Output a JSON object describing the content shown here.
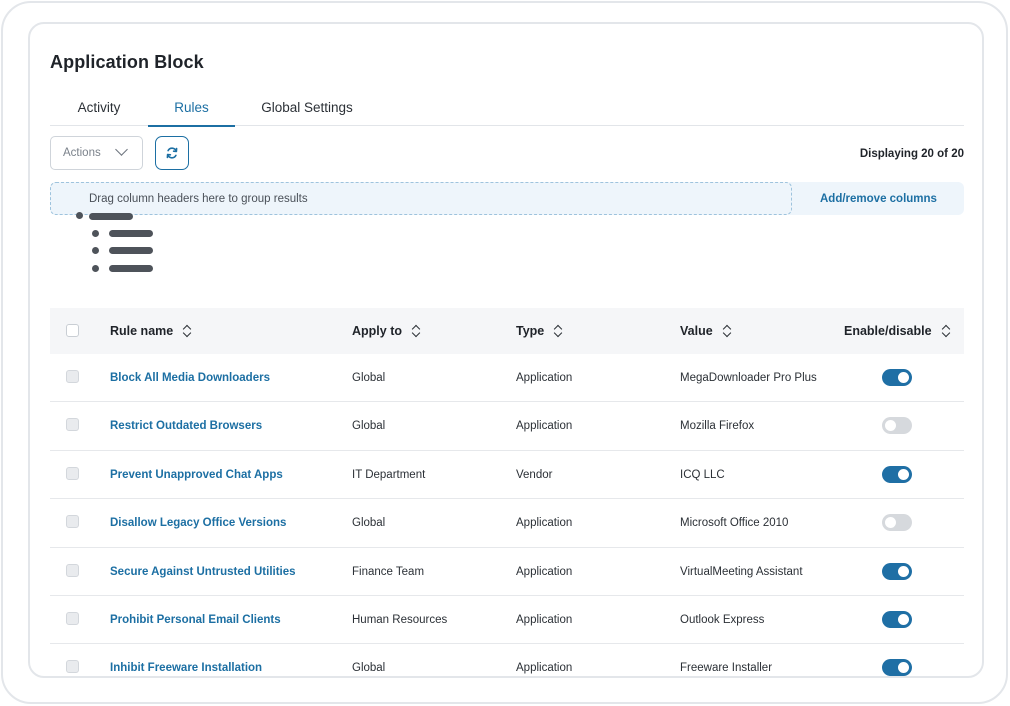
{
  "page": {
    "title": "Application Block"
  },
  "tabs": [
    {
      "label": "Activity",
      "active": false
    },
    {
      "label": "Rules",
      "active": true
    },
    {
      "label": "Global Settings",
      "active": false
    }
  ],
  "toolbar": {
    "actions_label": "Actions",
    "refresh_icon": "refresh-icon",
    "display_count": "Displaying 20 of 20"
  },
  "grouping": {
    "drop_hint": "Drag column headers here to group results",
    "add_remove_label": "Add/remove columns"
  },
  "table": {
    "columns": [
      "Rule name",
      "Apply to",
      "Type",
      "Value",
      "Enable/disable"
    ],
    "rows": [
      {
        "name": "Block All Media Downloaders",
        "apply_to": "Global",
        "type": "Application",
        "value": "MegaDownloader Pro Plus",
        "enabled": true
      },
      {
        "name": "Restrict Outdated Browsers",
        "apply_to": "Global",
        "type": "Application",
        "value": "Mozilla Firefox",
        "enabled": false
      },
      {
        "name": "Prevent Unapproved Chat Apps",
        "apply_to": "IT Department",
        "type": "Vendor",
        "value": "ICQ LLC",
        "enabled": true
      },
      {
        "name": "Disallow Legacy Office Versions",
        "apply_to": "Global",
        "type": "Application",
        "value": "Microsoft Office 2010",
        "enabled": false
      },
      {
        "name": "Secure Against Untrusted Utilities",
        "apply_to": "Finance Team",
        "type": "Application",
        "value": "VirtualMeeting Assistant",
        "enabled": true
      },
      {
        "name": "Prohibit Personal Email Clients",
        "apply_to": "Human Resources",
        "type": "Application",
        "value": "Outlook Express",
        "enabled": true
      },
      {
        "name": "Inhibit Freeware Installation",
        "apply_to": "Global",
        "type": "Application",
        "value": "Freeware Installer",
        "enabled": true
      }
    ]
  },
  "colors": {
    "accent": "#1c6fa3",
    "toggle_on": "#1f6fa5",
    "toggle_off": "#d6d9dd",
    "group_bar_bg": "#eef5fb"
  }
}
